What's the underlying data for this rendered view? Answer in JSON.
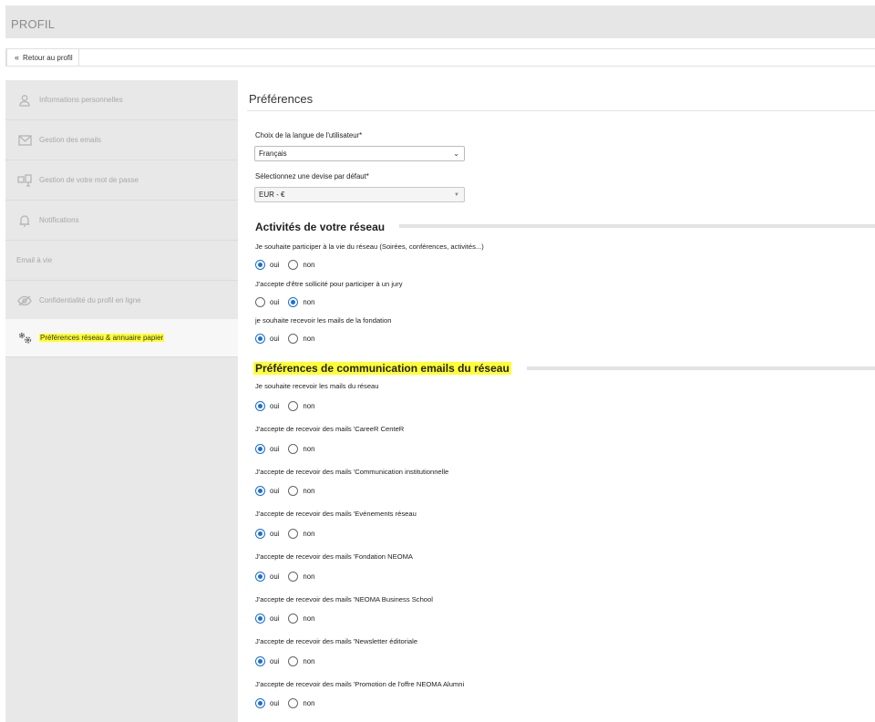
{
  "header": {
    "title": "PROFIL"
  },
  "toolbar": {
    "back_label": "Retour au profil"
  },
  "sidebar": {
    "items": [
      {
        "label": "Informations personnelles",
        "icon": "user-icon"
      },
      {
        "label": "Gestion des emails",
        "icon": "envelope-icon"
      },
      {
        "label": "Gestion de votre mot de passe",
        "icon": "password-icon"
      },
      {
        "label": "Notifications",
        "icon": "bell-icon"
      },
      {
        "label": "Email à vie",
        "icon": ""
      },
      {
        "label": "Confidentialité du profil en ligne",
        "icon": "eye-slash-icon"
      },
      {
        "label": "Préférences réseau & annuaire papier",
        "icon": "gears-icon",
        "active": true
      }
    ]
  },
  "main": {
    "title": "Préférences",
    "language": {
      "label": "Choix de la langue de l'utilisateur*",
      "value": "Français"
    },
    "currency": {
      "label": "Sélectionnez une devise par défaut*",
      "value": "EUR - €"
    },
    "section1": {
      "title": "Activités de votre réseau",
      "questions": [
        {
          "text": "Je souhaite participer à la vie du réseau (Soirées, conférences, activités...)",
          "value": "oui"
        },
        {
          "text": "J'accepte d'être sollicité pour participer à un jury",
          "value": "non"
        },
        {
          "text": "je souhaite recevoir les mails de la fondation",
          "value": "oui"
        }
      ]
    },
    "section2": {
      "title": "Préférences de communication emails du réseau",
      "questions": [
        {
          "text": "Je souhaite recevoir les mails du réseau",
          "value": "oui"
        },
        {
          "text": "J'accepte de recevoir des mails 'CareeR CenteR",
          "value": "oui"
        },
        {
          "text": "J'accepte de recevoir des mails 'Communication institutionnelle",
          "value": "oui"
        },
        {
          "text": "J'accepte de recevoir des mails 'Evénements réseau",
          "value": "oui"
        },
        {
          "text": "J'accepte de recevoir des mails 'Fondation NEOMA",
          "value": "oui"
        },
        {
          "text": "J'accepte de recevoir des mails 'NEOMA Business School",
          "value": "oui"
        },
        {
          "text": "J'accepte de recevoir des mails 'Newsletter éditoriale",
          "value": "oui"
        },
        {
          "text": "J'accepte de recevoir des mails 'Promotion de l'offre NEOMA Alumni",
          "value": "oui"
        }
      ]
    },
    "options": {
      "yes": "oui",
      "no": "non"
    }
  },
  "colors": {
    "accent": "#1a6fd8",
    "highlight": "#ffff33",
    "sidebar_bg": "#e8e8e8"
  }
}
